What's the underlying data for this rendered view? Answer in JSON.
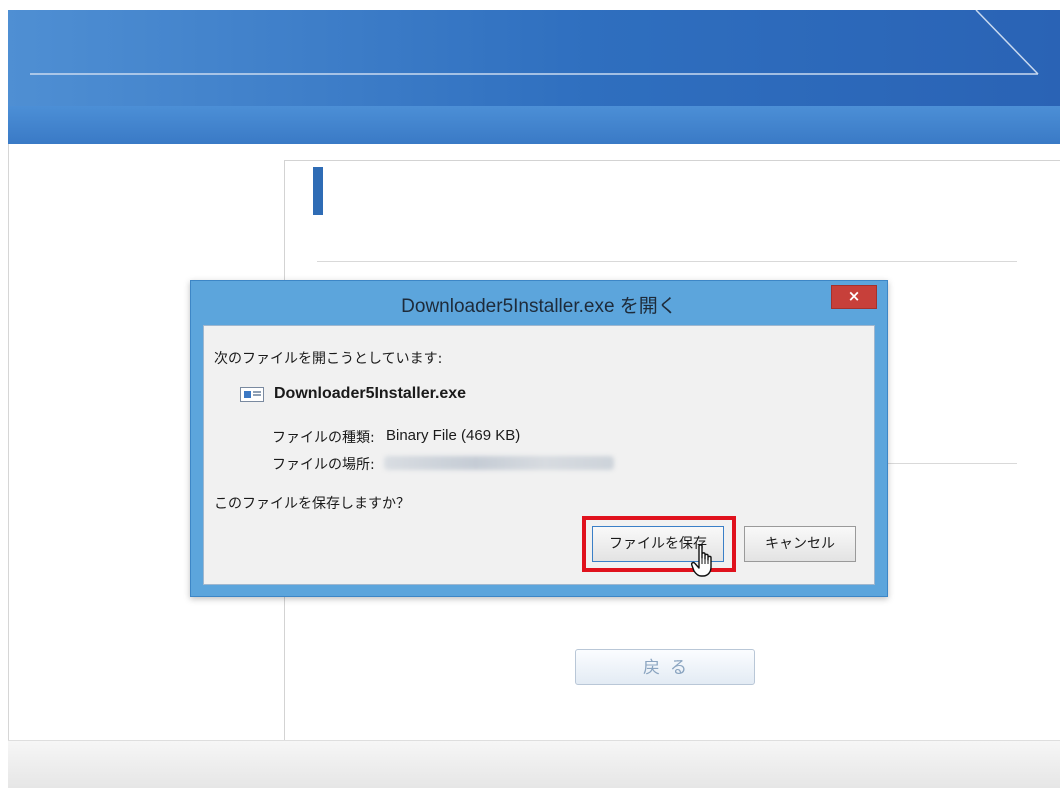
{
  "dialog": {
    "title": "Downloader5Installer.exe を開く",
    "close_glyph": "×",
    "prompt": "次のファイルを開こうとしています:",
    "file_name": "Downloader5Installer.exe",
    "file_type_label": "ファイルの種類:",
    "file_type_value": "Binary File (469 KB)",
    "file_location_label": "ファイルの場所:",
    "question": "このファイルを保存しますか？",
    "save_button": "ファイルを保存",
    "cancel_button": "キャンセル"
  },
  "page": {
    "back_button": "戻る"
  },
  "icons": {
    "file": "file-icon",
    "cursor": "hand-pointer-icon",
    "close": "close-icon"
  },
  "colors": {
    "header_blue": "#2f6fbf",
    "dialog_frame": "#5ca5dc",
    "close_red": "#c7403a",
    "highlight_red": "#e0121d"
  }
}
